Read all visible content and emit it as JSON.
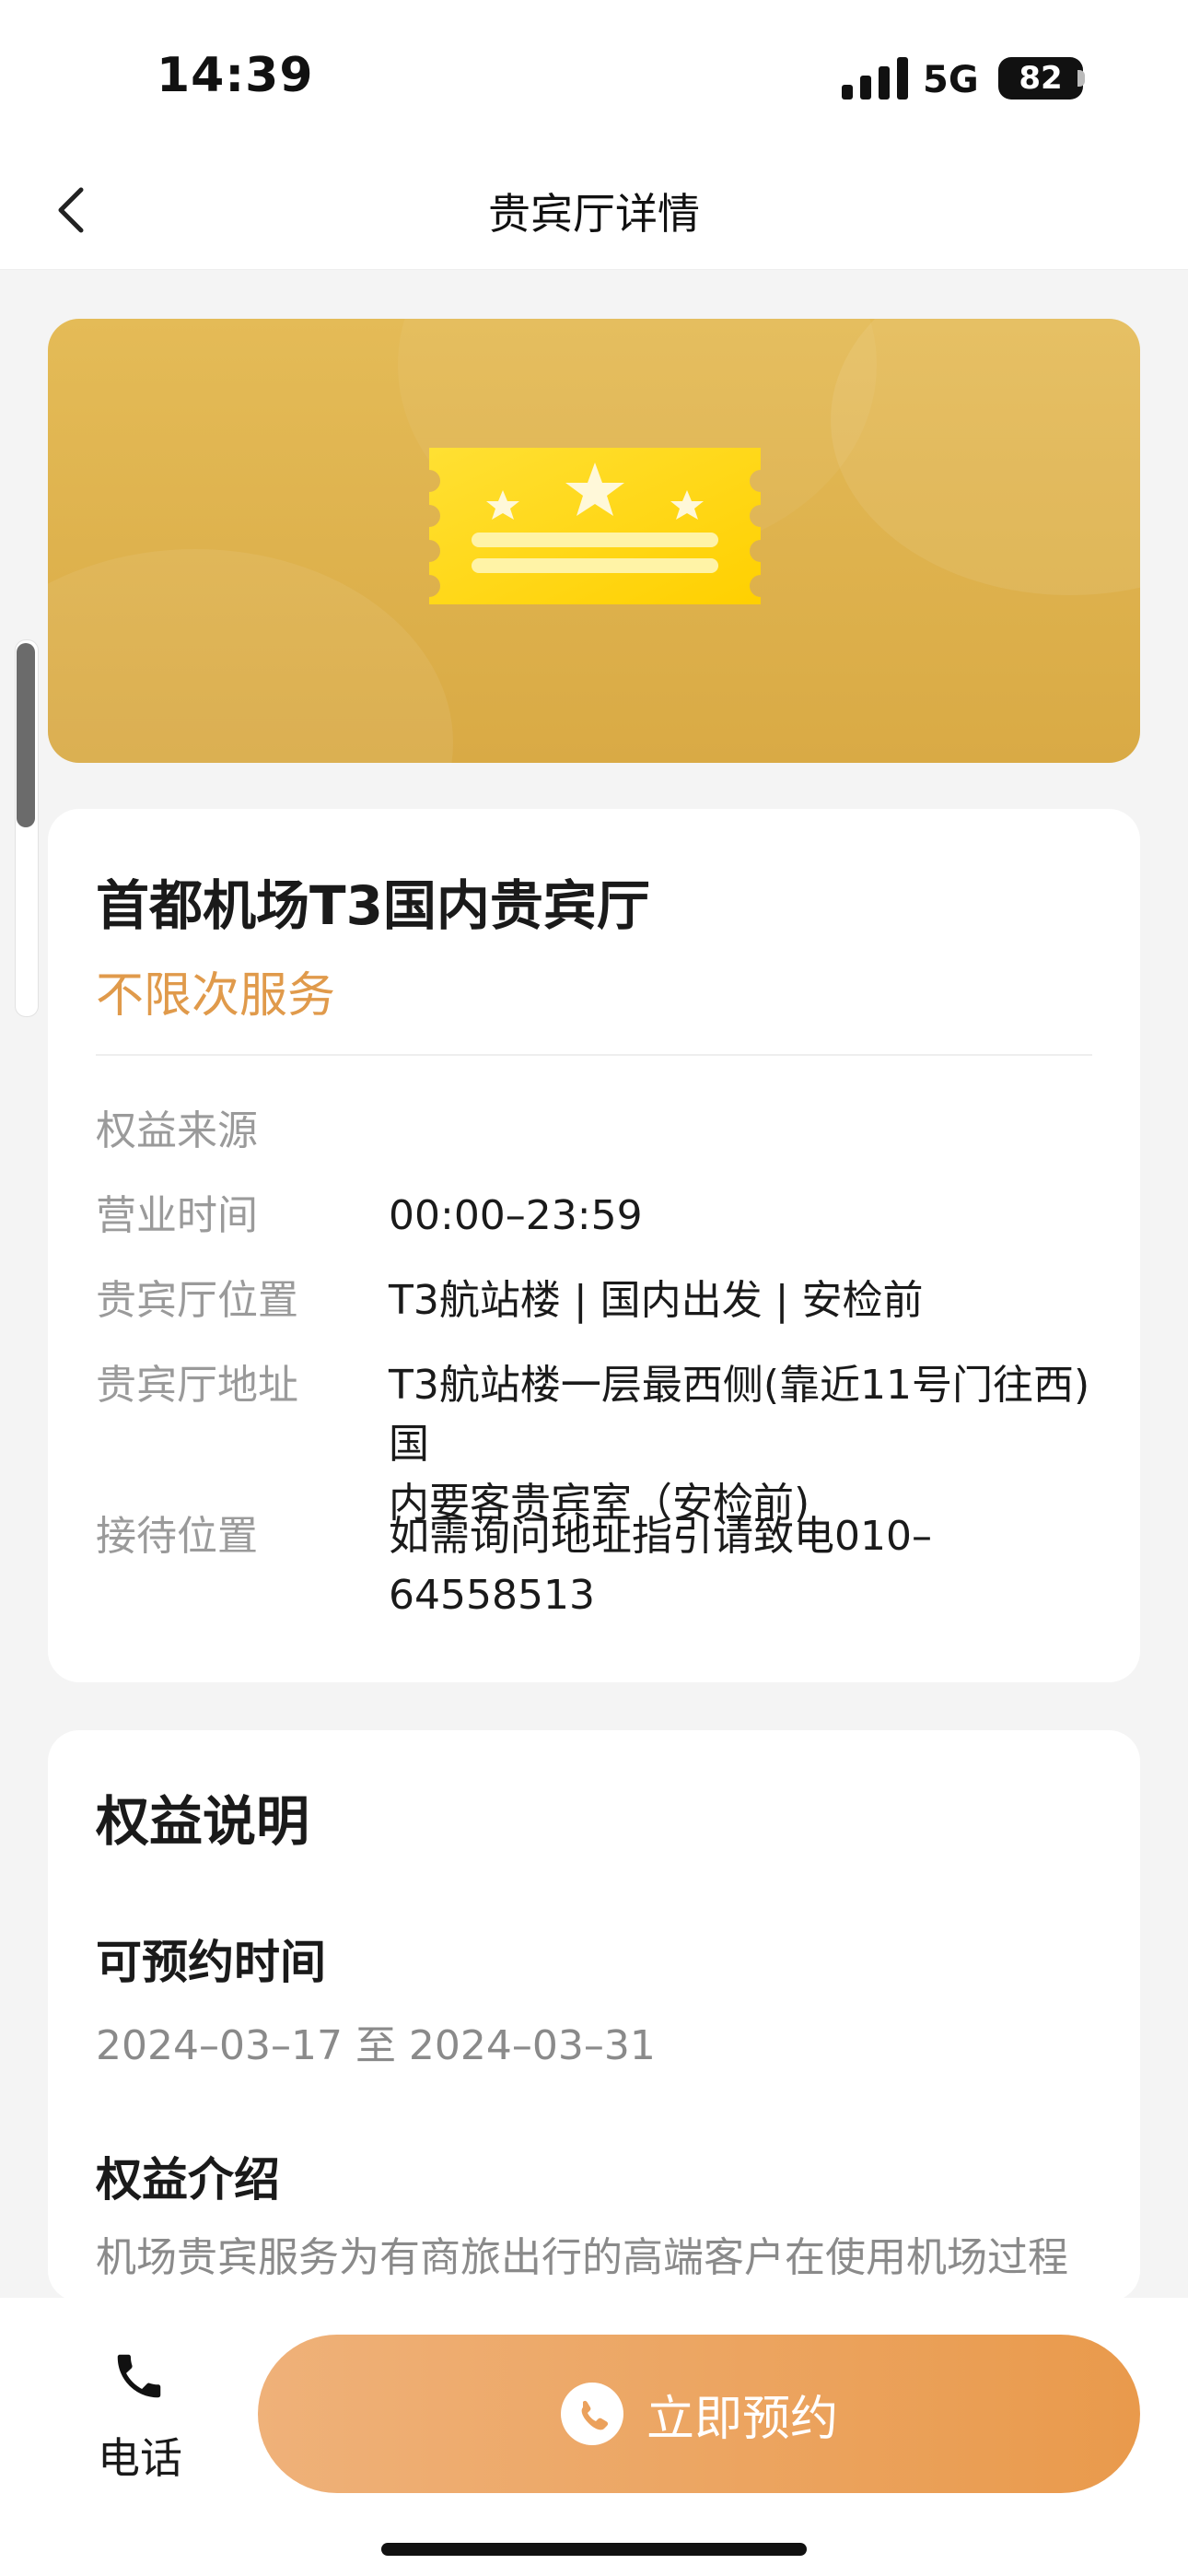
{
  "status_bar": {
    "time": "14:39",
    "network": "5G",
    "battery": "82"
  },
  "nav": {
    "title": "贵宾厅详情",
    "back_icon": "chevron-left-icon"
  },
  "banner": {
    "icon": "ticket-stars-icon"
  },
  "lounge": {
    "name": "首都机场T3国内贵宾厅",
    "service_type": "不限次服务",
    "details": [
      {
        "label": "权益来源",
        "value": ""
      },
      {
        "label": "营业时间",
        "value": "00:00–23:59"
      },
      {
        "label": "贵宾厅位置",
        "value": "T3航站楼 | 国内出发 | 安检前"
      },
      {
        "label": "贵宾厅地址",
        "value_line1": "T3航站楼一层最西侧(靠近11号门往西)国",
        "value_line2": "内要客贵宾室（安检前)"
      },
      {
        "label": "接待位置",
        "value": "如需询问地址指引请致电010–64558513"
      }
    ]
  },
  "benefits": {
    "title": "权益说明",
    "booking_time": {
      "title": "可预约时间",
      "value": "2024–03–17 至 2024–03–31"
    },
    "intro": {
      "title": "权益介绍",
      "text": "机场贵宾服务为有商旅出行的高端客户在使用机场过程"
    }
  },
  "bottom_bar": {
    "phone_label": "电话",
    "book_label": "立即预约",
    "phone_icon": "phone-icon"
  },
  "colors": {
    "accent": "#e99a4c",
    "service_text": "#e09a4b",
    "banner": "#deb14d"
  }
}
